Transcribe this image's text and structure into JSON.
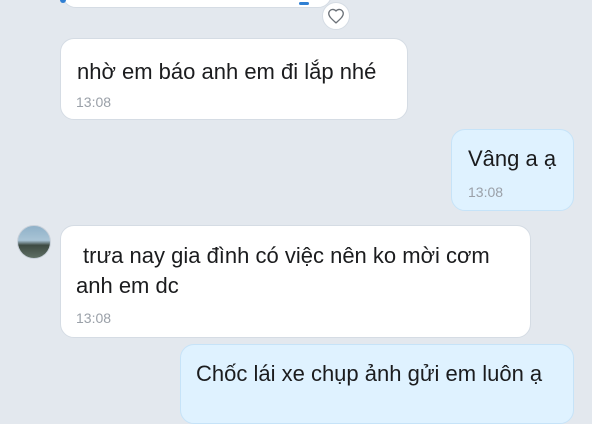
{
  "messages": [
    {
      "text": "nhờ em báo anh em đi lắp nhé",
      "time": "13:08"
    },
    {
      "text": "Vâng a ạ",
      "time": "13:08"
    },
    {
      "line1": "trưa nay gia đình có việc nên ko mời cơm",
      "line2": "anh em dc",
      "time": "13:08"
    },
    {
      "text": "Chốc lái xe chụp ảnh gửi em luôn ạ"
    }
  ],
  "icons": {
    "reaction": "heart-icon",
    "avatar": "contact-avatar"
  },
  "colors": {
    "background": "#e3e8ee",
    "incoming_bubble": "#ffffff",
    "outgoing_bubble": "#dff2ff",
    "time_text": "#9aa0a8",
    "accent": "#2f7fd3"
  }
}
